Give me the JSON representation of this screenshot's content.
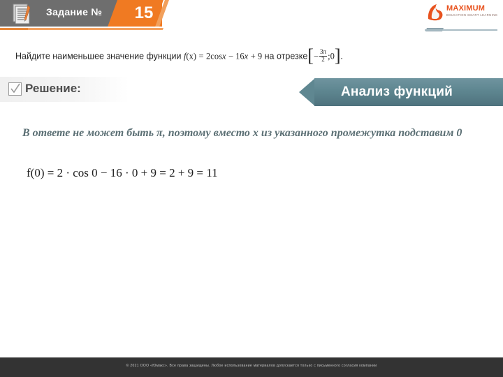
{
  "header": {
    "title": "Задание №",
    "number": "15",
    "doc_icon": "document-pencil-icon"
  },
  "logo": {
    "name": "MAXIMUM",
    "subtitle": "EDUCATION\nSMART LEARNING",
    "mark": "maximum-flame-icon"
  },
  "task": {
    "prefix": "Найдите наименьшее значение функции",
    "fx": "f",
    "fx_arg": "(x)",
    "equals": "=",
    "expr": "2cos",
    "expr_var": "x",
    "expr_rest": "− 16",
    "expr_var2": "x",
    "expr_tail": "+ 9",
    "segment_word": "на отрезке",
    "seg_open": "[",
    "seg_minus": "−",
    "frac_num": "3π",
    "frac_den": "2",
    "seg_sep": ";",
    "seg_zero": "0",
    "seg_close": "]",
    "period": "."
  },
  "solution": {
    "label": "Решение:",
    "check_icon": "checkbox-checked-icon"
  },
  "banner": {
    "title": "Анализ функций"
  },
  "content": {
    "note": "В ответе не может быть π, поэтому вместо x из указанного промежутка подставим 0",
    "math": "f(0)  = 2 · cos 0 − 16 · 0 + 9 = 2 + 9 = 11"
  },
  "footer": {
    "copyright": "© 2021 ООО «Юмакс». Все права защищены. Любое использование материалов допускается только с письменного согласия компании"
  },
  "colors": {
    "orange": "#f07a22",
    "gray_header": "#6e6e6e",
    "banner_teal": "#5f8791",
    "note_text": "#5b6f74",
    "footer_bg": "#333333"
  }
}
